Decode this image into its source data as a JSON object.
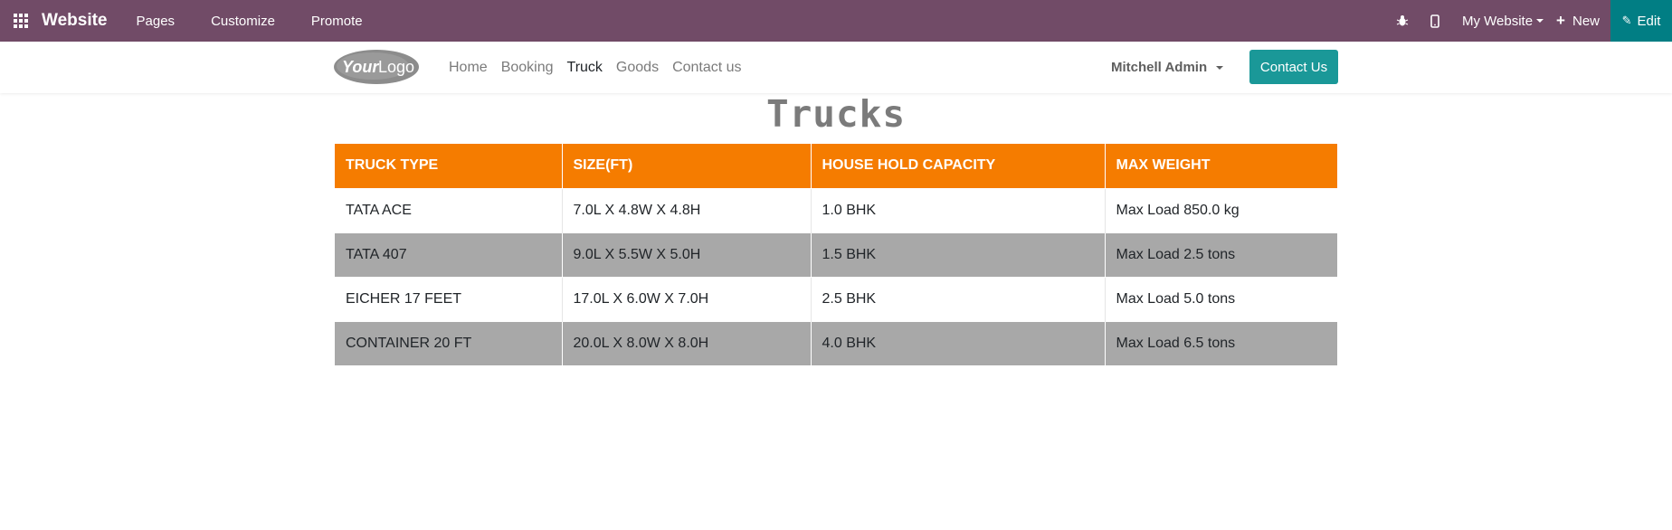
{
  "admin_bar": {
    "brand": "Website",
    "menus": [
      "Pages",
      "Customize",
      "Promote"
    ],
    "my_website": "My Website",
    "new_label": "New",
    "edit_label": "Edit"
  },
  "header": {
    "logo_text": "YourLogo",
    "nav": [
      "Home",
      "Booking",
      "Truck",
      "Goods",
      "Contact us"
    ],
    "active_nav": "Truck",
    "user": "Mitchell Admin",
    "contact_button": "Contact Us"
  },
  "page": {
    "title": "Trucks",
    "table": {
      "headers": [
        "TRUCK TYPE",
        "SIZE(FT)",
        "HOUSE HOLD CAPACITY",
        "MAX WEIGHT"
      ],
      "rows": [
        [
          "TATA ACE",
          "7.0L X 4.8W X 4.8H",
          "1.0 BHK",
          "Max Load 850.0 kg"
        ],
        [
          "TATA 407",
          "9.0L X 5.5W X 5.0H",
          "1.5 BHK",
          "Max Load 2.5 tons"
        ],
        [
          "EICHER 17 FEET",
          "17.0L X 6.0W X 7.0H",
          "2.5 BHK",
          "Max Load 5.0 tons"
        ],
        [
          "CONTAINER 20 FT",
          "20.0L X 8.0W X 8.0H",
          "4.0 BHK",
          "Max Load 6.5 tons"
        ]
      ]
    }
  },
  "colors": {
    "admin_bar": "#714b67",
    "edit_button": "#017e84",
    "contact_button": "#1a9898",
    "table_header": "#f57c00",
    "row_alt": "#a8a8a8"
  }
}
